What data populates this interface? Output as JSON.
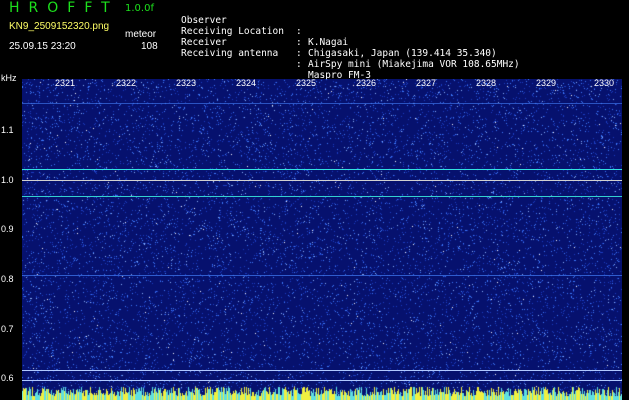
{
  "header": {
    "brand": "HROFFT",
    "version": "1.0.0f",
    "filename": "KN9_2509152320.png",
    "mode": "meteor",
    "timestamp": "25.09.15 23:20",
    "count": "108",
    "meta": [
      {
        "label": "Observer",
        "value": "K.Nagai"
      },
      {
        "label": "Receiving Location",
        "value": "Chigasaki, Japan (139.414 35.340)"
      },
      {
        "label": "Receiver",
        "value": "AirSpy mini (Miakejima VOR 108.65MHz)"
      },
      {
        "label": "Receiving antenna",
        "value": "Maspro FM-3"
      }
    ],
    "separator": ":"
  },
  "axes": {
    "y_unit": "kHz",
    "y_ticks": [
      "1.1",
      "1.0",
      "0.9",
      "0.8",
      "0.7",
      "0.6"
    ],
    "x_ticks": [
      "2321",
      "2322",
      "2323",
      "2324",
      "2325",
      "2326",
      "2327",
      "2328",
      "2329",
      "2330"
    ]
  },
  "colors": {
    "background": "#06116e",
    "noise": "#4a8bff",
    "line_cyan": "#33e0e0",
    "line_yellow": "#f0f040",
    "label": "#ffffff",
    "brand": "#1de11d"
  }
}
